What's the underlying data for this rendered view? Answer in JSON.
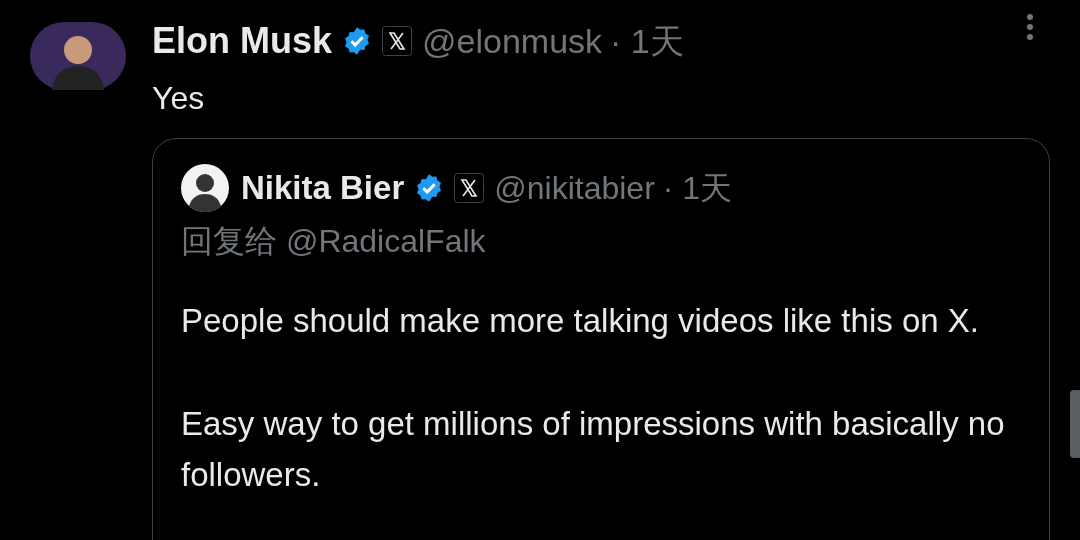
{
  "tweet": {
    "author": "Elon Musk",
    "verified": true,
    "affiliate_badge": true,
    "handle": "@elonmusk",
    "time": "· 1天",
    "text": "Yes",
    "quote": {
      "author": "Nikita Bier",
      "verified": true,
      "affiliate_badge": true,
      "handle": "@nikitabier",
      "time": "· 1天",
      "reply_to": "回复给 @RadicalFalk",
      "paragraphs": [
        "People should make more talking videos like this on X.",
        "Easy way to get millions of impressions with basically no followers."
      ]
    }
  }
}
